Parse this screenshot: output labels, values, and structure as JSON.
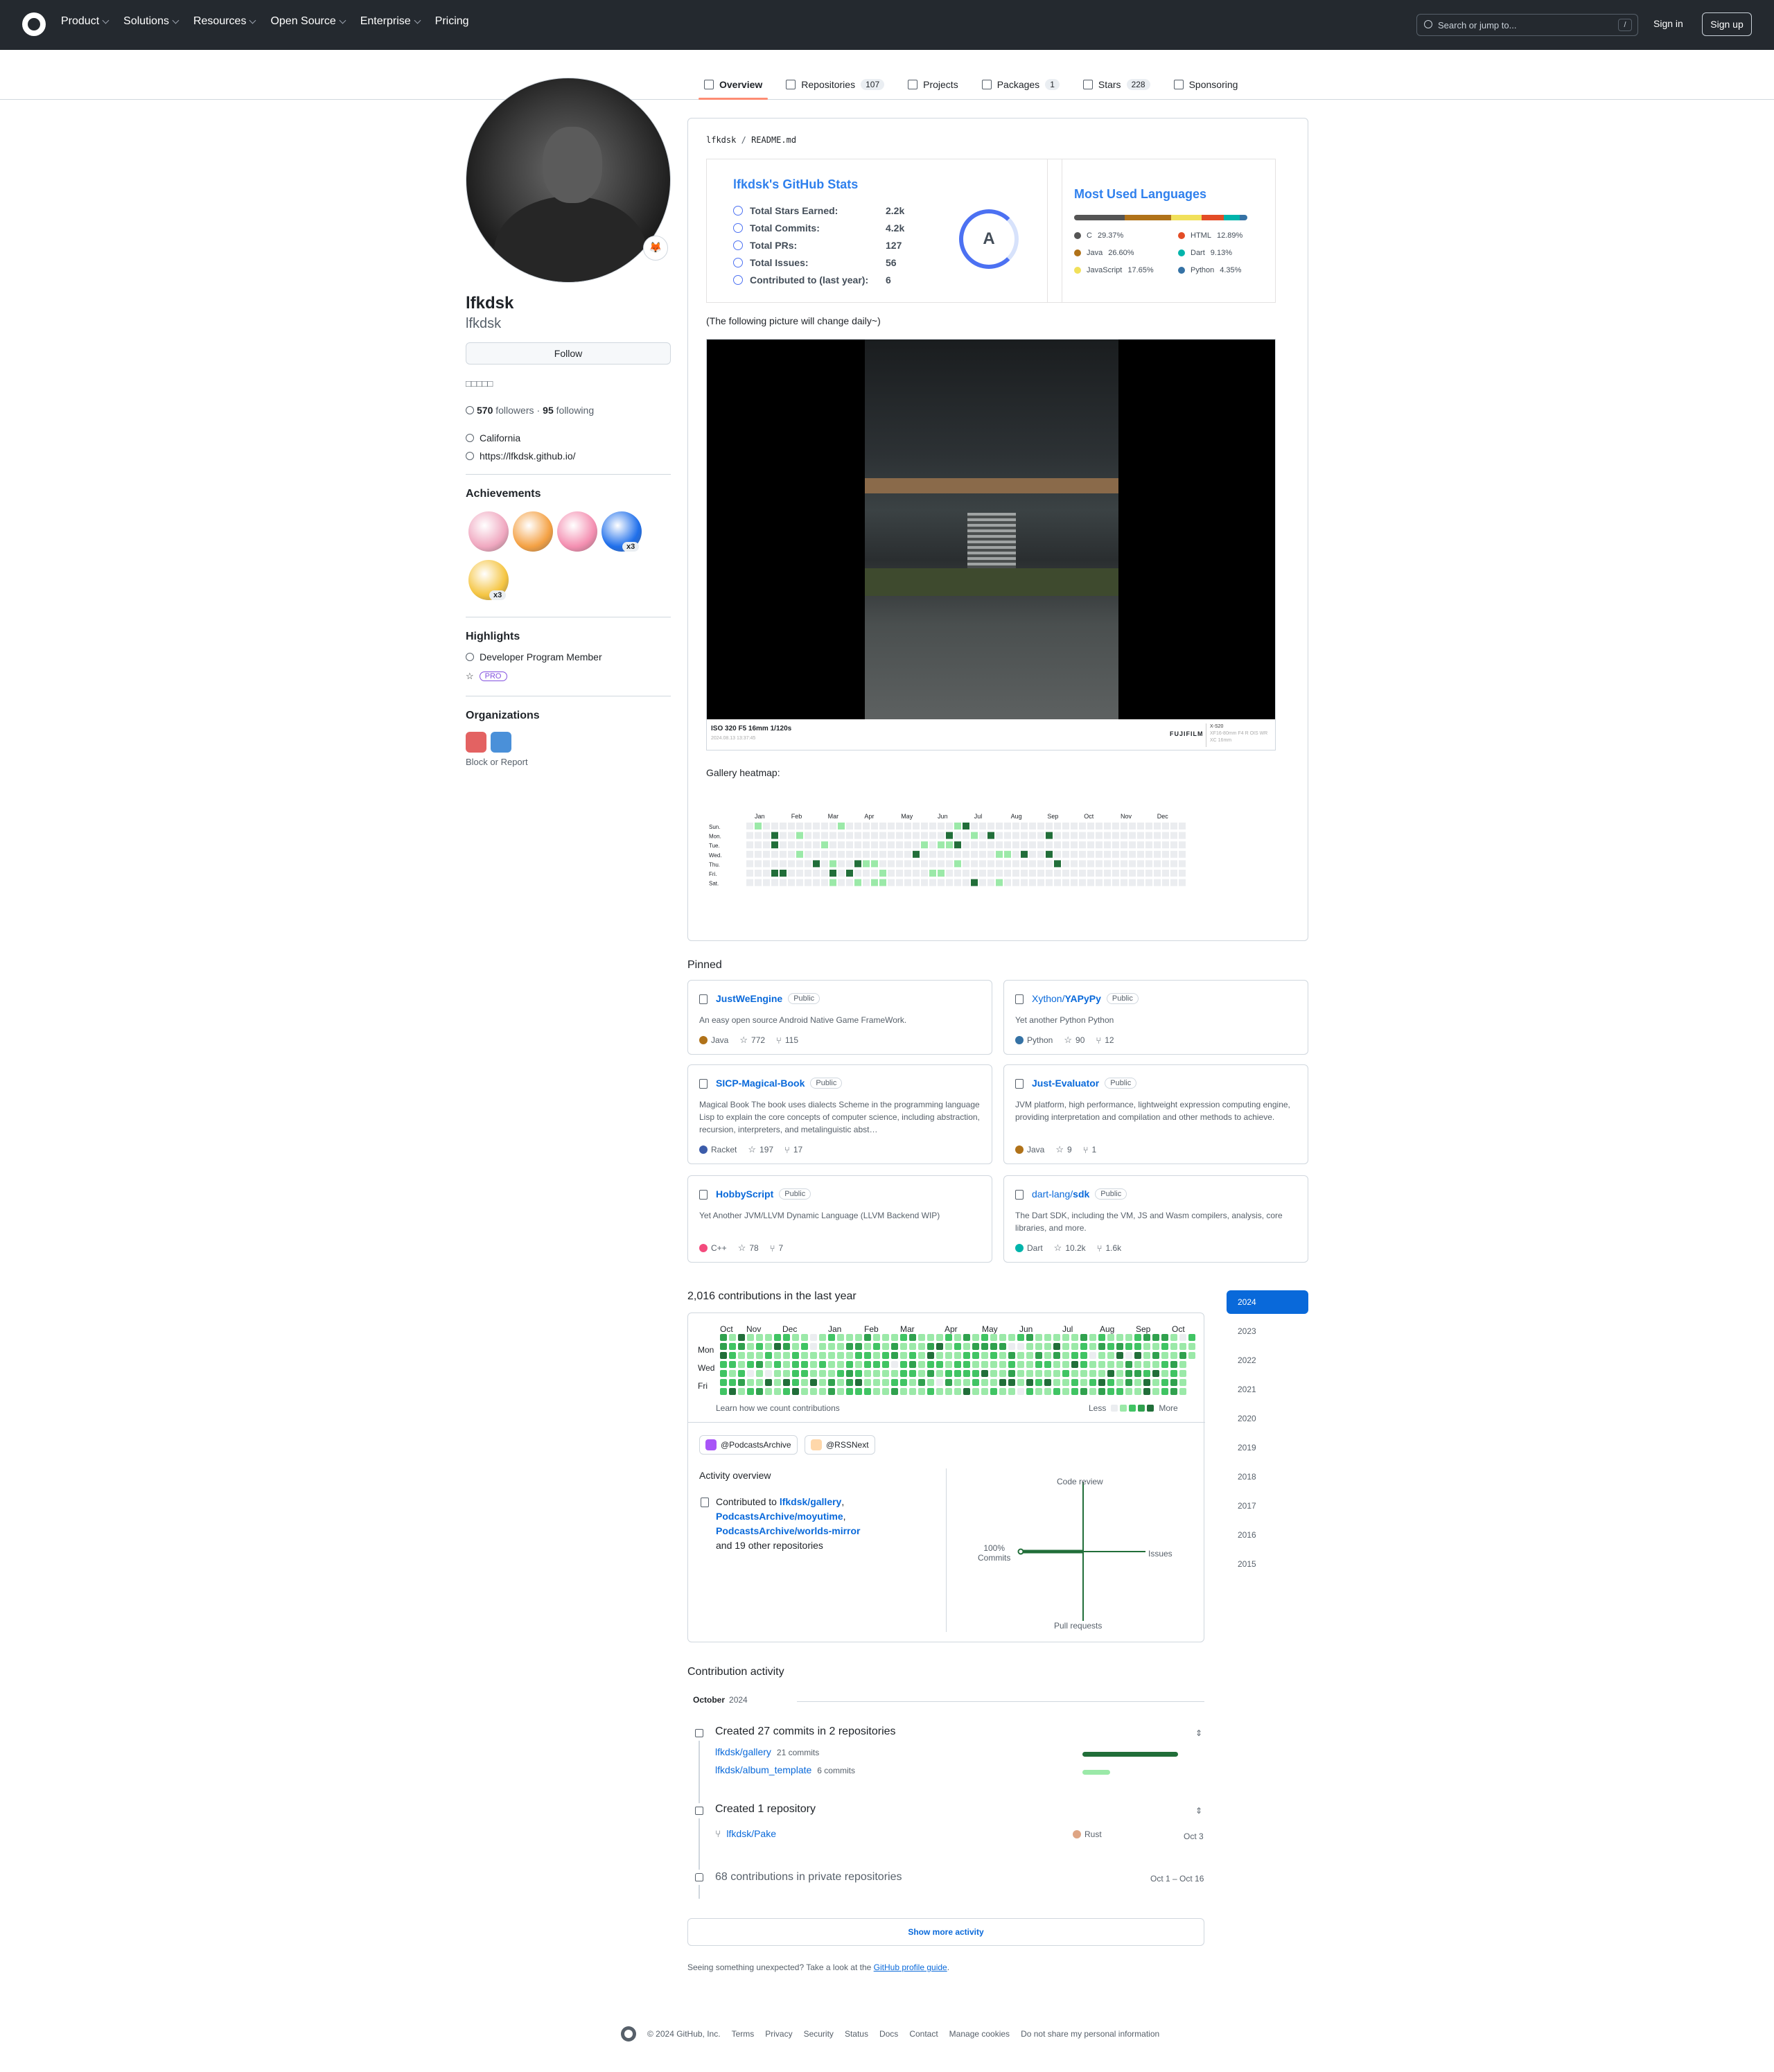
{
  "header": {
    "nav": [
      "Product",
      "Solutions",
      "Resources",
      "Open Source",
      "Enterprise",
      "Pricing"
    ],
    "nav_has_dropdown": [
      true,
      true,
      true,
      true,
      true,
      false
    ],
    "search_placeholder": "Search or jump to...",
    "search_shortcut": "/",
    "sign_in": "Sign in",
    "sign_up": "Sign up"
  },
  "tabs": [
    {
      "label": "Overview",
      "count": "",
      "active": true,
      "icon": "book-icon"
    },
    {
      "label": "Repositories",
      "count": "107",
      "active": false,
      "icon": "repo-icon"
    },
    {
      "label": "Projects",
      "count": "",
      "active": false,
      "icon": "table-icon"
    },
    {
      "label": "Packages",
      "count": "1",
      "active": false,
      "icon": "package-icon"
    },
    {
      "label": "Stars",
      "count": "228",
      "active": false,
      "icon": "star-icon"
    },
    {
      "label": "Sponsoring",
      "count": "",
      "active": false,
      "icon": "heart-icon"
    }
  ],
  "profile": {
    "name": "lfkdsk",
    "login": "lfkdsk",
    "status_emoji": "🦊",
    "follow_label": "Follow",
    "bio": "□□□□□",
    "followers": "570",
    "followers_label": "followers",
    "separator": "·",
    "following": "95",
    "following_label": "following",
    "location": "California",
    "website": "https://lfkdsk.github.io/"
  },
  "achievements": {
    "title": "Achievements",
    "badges": [
      {
        "name": "heart-on-your-sleeve",
        "color": "#f0a8c0",
        "multiplier": ""
      },
      {
        "name": "pull-shark",
        "color": "#f4a144",
        "multiplier": ""
      },
      {
        "name": "yolo",
        "color": "#f48fb1",
        "multiplier": ""
      },
      {
        "name": "pair-extraordinaire",
        "color": "#1f6feb",
        "multiplier": "x3"
      },
      {
        "name": "quickdraw",
        "color": "#f5c542",
        "multiplier": "x3"
      }
    ]
  },
  "highlights": {
    "title": "Highlights",
    "items": [
      "Developer Program Member"
    ],
    "pro_badge": "PRO"
  },
  "organizations": {
    "title": "Organizations",
    "orgs": [
      {
        "name": "org-1",
        "color": "#e36262"
      },
      {
        "name": "org-2",
        "color": "#4a90d9"
      }
    ],
    "block_label": "Block or Report"
  },
  "readme": {
    "path_owner": "lfkdsk",
    "path_sep": "/",
    "path_file": "README.md",
    "stats": {
      "title": "lfkdsk's GitHub Stats",
      "rows": [
        {
          "label": "Total Stars Earned:",
          "value": "2.2k"
        },
        {
          "label": "Total Commits:",
          "value": "4.2k"
        },
        {
          "label": "Total PRs:",
          "value": "127"
        },
        {
          "label": "Total Issues:",
          "value": "56"
        },
        {
          "label": "Contributed to (last year):",
          "value": "6"
        }
      ],
      "rank": "A"
    },
    "languages": {
      "title": "Most Used Languages",
      "items": [
        {
          "name": "C",
          "percent": "29.37%",
          "value": 29.37,
          "color": "#555555"
        },
        {
          "name": "HTML",
          "percent": "12.89%",
          "value": 12.89,
          "color": "#e34c26"
        },
        {
          "name": "Java",
          "percent": "26.60%",
          "value": 26.6,
          "color": "#b07219"
        },
        {
          "name": "Dart",
          "percent": "9.13%",
          "value": 9.13,
          "color": "#00b4ab"
        },
        {
          "name": "JavaScript",
          "percent": "17.65%",
          "value": 17.65,
          "color": "#f1e05a"
        },
        {
          "name": "Python",
          "percent": "4.35%",
          "value": 4.35,
          "color": "#3572a5"
        }
      ]
    },
    "daily_note": "(The following picture will change daily~)",
    "photo": {
      "exif": "ISO 320 F5 16mm 1/120s",
      "date": "2024.08.13 13:37:45",
      "brand": "FUJIFILM",
      "model": "X-S20",
      "lens_line1": "XF16-80mm F4 R OIS WR",
      "lens_line2": "XC 16mm"
    },
    "gallery_label": "Gallery heatmap:",
    "heatmap": {
      "months": [
        "Jan",
        "Feb",
        "Mar",
        "Apr",
        "May",
        "Jun",
        "Jul",
        "Aug",
        "Sep",
        "Oct",
        "Nov",
        "Dec"
      ],
      "days": [
        "Sun.",
        "Mon.",
        "Tue.",
        "Wed.",
        "Thu.",
        "Fri.",
        "Sat."
      ]
    }
  },
  "pinned": {
    "title": "Pinned",
    "items": [
      {
        "owner": "",
        "name": "JustWeEngine",
        "badge": "Public",
        "desc": "An easy open source Android Native Game FrameWork.",
        "lang": "Java",
        "lang_color": "#b07219",
        "stars": "772",
        "forks": "115"
      },
      {
        "owner": "Xython/",
        "name": "YAPyPy",
        "badge": "Public",
        "desc": "Yet another Python Python",
        "lang": "Python",
        "lang_color": "#3572a5",
        "stars": "90",
        "forks": "12"
      },
      {
        "owner": "",
        "name": "SICP-Magical-Book",
        "badge": "Public",
        "desc": "Magical Book The book uses dialects Scheme in the programming language Lisp to explain the core concepts of computer science, including abstraction, recursion, interpreters, and metalinguistic abst…",
        "lang": "Racket",
        "lang_color": "#3c5caa",
        "stars": "197",
        "forks": "17"
      },
      {
        "owner": "",
        "name": "Just-Evaluator",
        "badge": "Public",
        "desc": "JVM platform, high performance, lightweight expression computing engine, providing interpretation and compilation and other methods to achieve.",
        "lang": "Java",
        "lang_color": "#b07219",
        "stars": "9",
        "forks": "1"
      },
      {
        "owner": "",
        "name": "HobbyScript",
        "badge": "Public",
        "desc": "Yet Another JVM/LLVM Dynamic Language (LLVM Backend WIP)",
        "lang": "C++",
        "lang_color": "#f34b7d",
        "stars": "78",
        "forks": "7"
      },
      {
        "owner": "dart-lang/",
        "name": "sdk",
        "badge": "Public",
        "desc": "The Dart SDK, including the VM, JS and Wasm compilers, analysis, core libraries, and more.",
        "lang": "Dart",
        "lang_color": "#00b4ab",
        "stars": "10.2k",
        "forks": "1.6k"
      }
    ]
  },
  "contributions": {
    "title": "2,016 contributions in the last year",
    "months": [
      "Oct",
      "Nov",
      "Dec",
      "Jan",
      "Feb",
      "Mar",
      "Apr",
      "May",
      "Jun",
      "Jul",
      "Aug",
      "Sep",
      "Oct"
    ],
    "days": [
      "Mon",
      "Wed",
      "Fri"
    ],
    "learn": "Learn how we count contributions",
    "less": "Less",
    "more": "More",
    "levels": [
      "#ebedf0",
      "#9be9a8",
      "#40c463",
      "#30a14e",
      "#216e39"
    ],
    "orgs": [
      "@PodcastsArchive",
      "@RSSNext"
    ],
    "activity_title": "Activity overview",
    "activity_prefix": "Contributed to",
    "activity_repos": [
      "lfkdsk/gallery",
      "PodcastsArchive/moyutime",
      "PodcastsArchive/worlds-mirror"
    ],
    "activity_suffix": "and 19 other repositories",
    "radar": {
      "code_review": "Code review",
      "issues": "Issues",
      "pull_requests": "Pull requests",
      "commits": "Commits",
      "commits_percent": "100%",
      "commits_value": 100,
      "issues_value": 0,
      "prs_value": 0,
      "review_value": 0
    }
  },
  "years": [
    "2024",
    "2023",
    "2022",
    "2021",
    "2020",
    "2019",
    "2018",
    "2017",
    "2016",
    "2015"
  ],
  "activity": {
    "title": "Contribution activity",
    "month": "October",
    "year": "2024",
    "commits_title": "Created 27 commits in 2 repositories",
    "commit_repos": [
      {
        "name": "lfkdsk/gallery",
        "count": "21 commits",
        "share": 1.0,
        "color": "#216e39"
      },
      {
        "name": "lfkdsk/album_template",
        "count": "6 commits",
        "share": 0.29,
        "color": "#9be9a8"
      }
    ],
    "repo_title": "Created 1 repository",
    "new_repo": {
      "name": "lfkdsk/Pake",
      "lang": "Rust",
      "lang_color": "#dea584",
      "date": "Oct 3"
    },
    "private_text": "68 contributions in private repositories",
    "private_date": "Oct 1 – Oct 16",
    "show_more": "Show more activity",
    "hint_text": "Seeing something unexpected? Take a look at the",
    "hint_link": "GitHub profile guide",
    "hint_end": "."
  },
  "footer": {
    "copyright": "© 2024 GitHub, Inc.",
    "links": [
      "Terms",
      "Privacy",
      "Security",
      "Status",
      "Docs",
      "Contact",
      "Manage cookies",
      "Do not share my personal information"
    ]
  }
}
